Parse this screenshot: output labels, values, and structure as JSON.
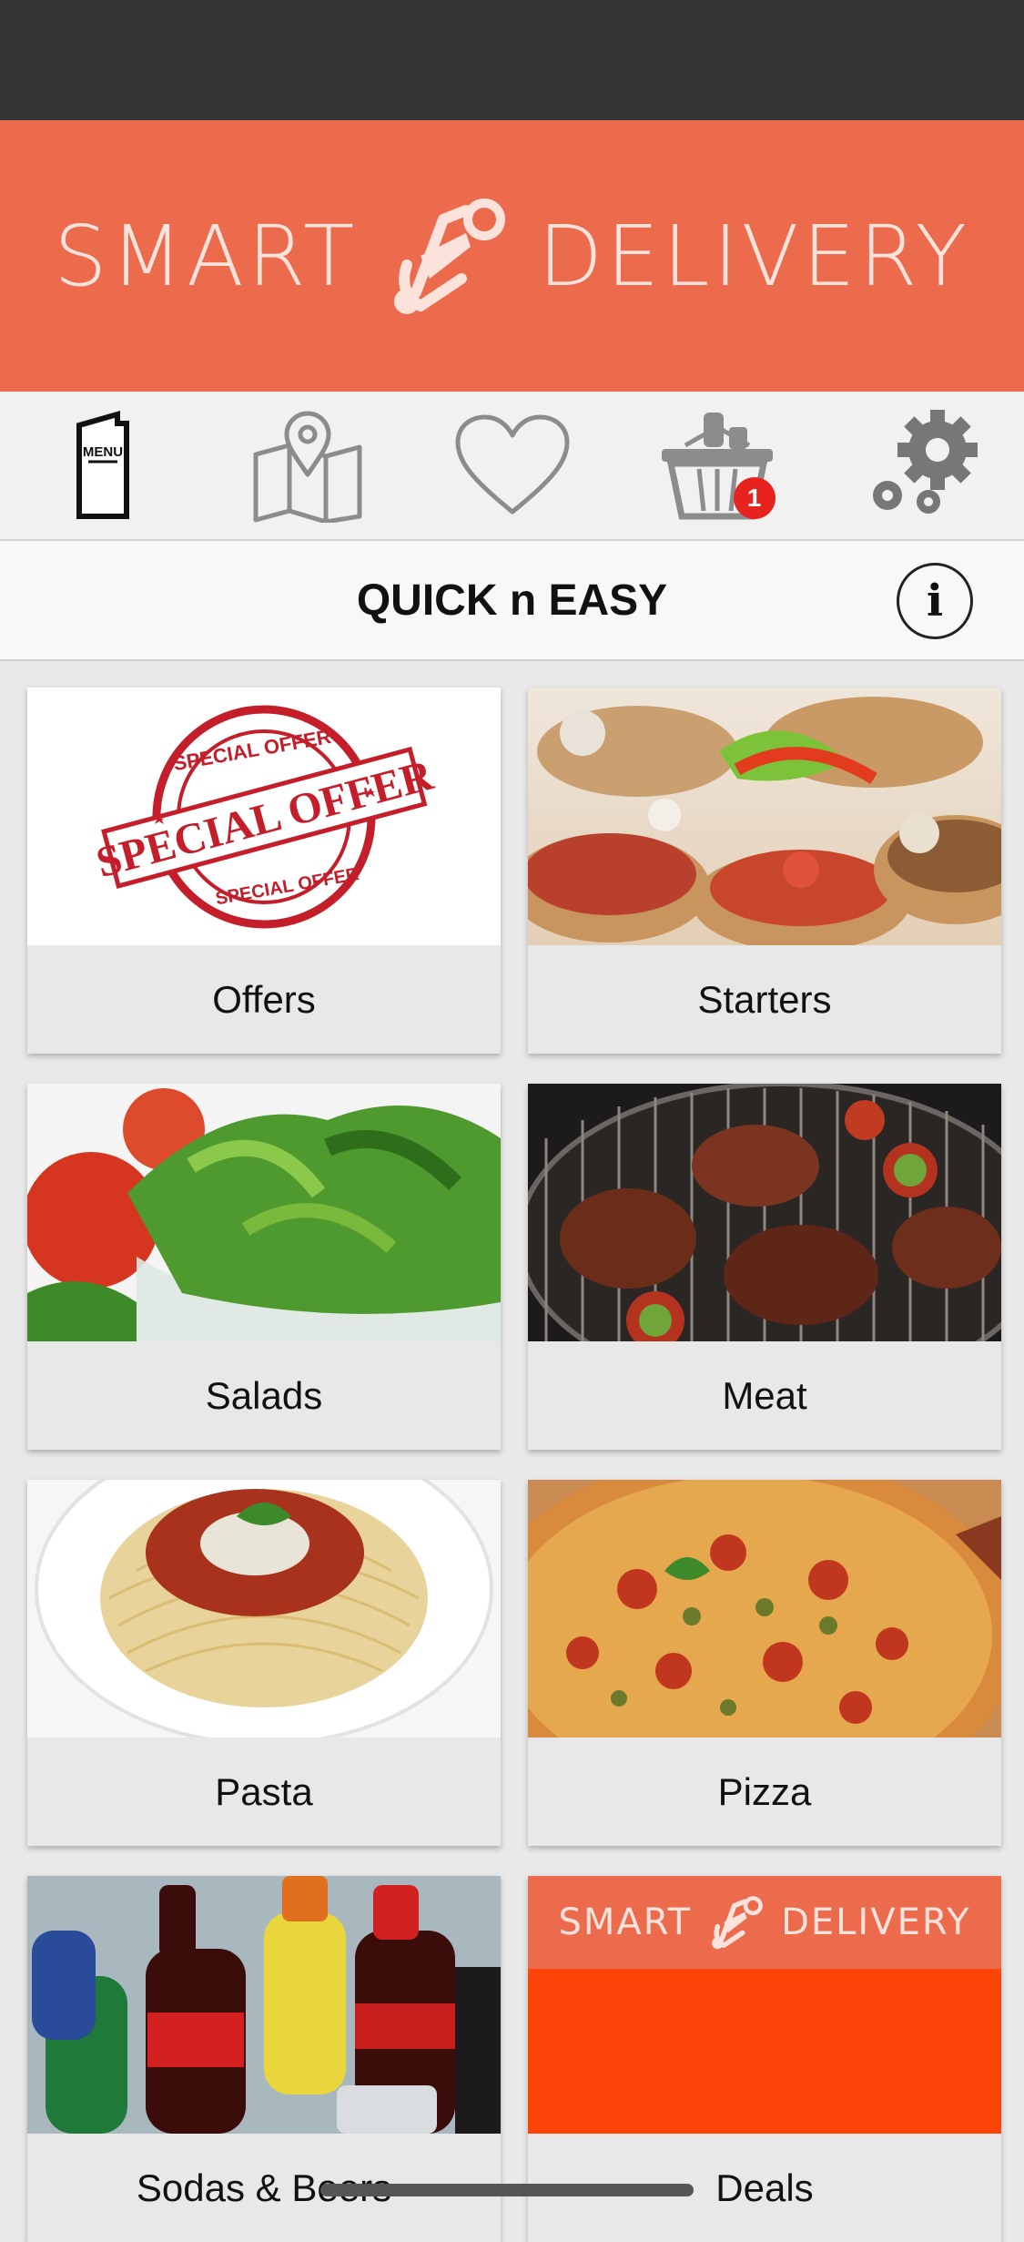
{
  "header": {
    "brand_left": "SMART",
    "brand_right": "DELIVERY",
    "brand_color": "#ec6b4d"
  },
  "nav": {
    "menu_icon_text": "MENU",
    "items": [
      {
        "icon": "menu-icon"
      },
      {
        "icon": "map-icon"
      },
      {
        "icon": "heart-icon"
      },
      {
        "icon": "basket-icon",
        "badge": "1"
      },
      {
        "icon": "gear-icon"
      }
    ]
  },
  "title_bar": {
    "title": "QUICK n EASY",
    "info_glyph": "i"
  },
  "categories": [
    {
      "label": "Offers",
      "image": "special-offer-stamp"
    },
    {
      "label": "Starters",
      "image": "bruschetta"
    },
    {
      "label": "Salads",
      "image": "green-salad"
    },
    {
      "label": "Meat",
      "image": "grilled-steaks"
    },
    {
      "label": "Pasta",
      "image": "spaghetti"
    },
    {
      "label": "Pizza",
      "image": "pizza"
    },
    {
      "label": "Sodas & Beers",
      "image": "soda-bottles"
    },
    {
      "label": "Deals",
      "image": "smart-delivery-banner"
    }
  ],
  "offer_stamp": {
    "top_text": "SPECIAL OFFER",
    "main_text": "SPECIAL OFFER",
    "bottom_text": "SPECIAL OFFER"
  },
  "deals_banner": {
    "brand_left": "SMART",
    "brand_right": "DELIVERY"
  },
  "colors": {
    "accent": "#ec6b4d",
    "badge": "#e8231f",
    "deals_orange": "#fd4409"
  }
}
